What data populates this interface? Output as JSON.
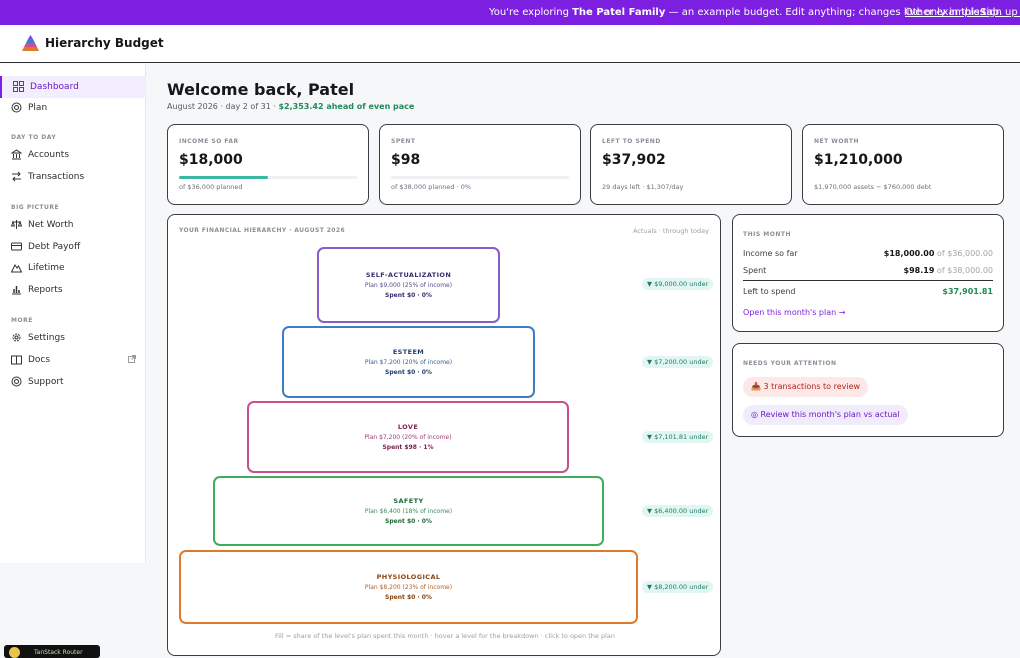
{
  "banner": {
    "prefix": "You're exploring ",
    "family": "The Patel Family",
    "suffix": " — an example budget. Edit anything; changes live only in this tab.",
    "other_examples": "Other examples",
    "sign_up": "Sign up fr"
  },
  "header": {
    "brand": "Hierarchy Budget"
  },
  "sidebar": {
    "items": [
      {
        "label": "Dashboard",
        "icon": "grid-icon"
      },
      {
        "label": "Plan",
        "icon": "target-icon"
      }
    ],
    "section_day": "DAY TO DAY",
    "day_items": [
      {
        "label": "Accounts",
        "icon": "bank-icon"
      },
      {
        "label": "Transactions",
        "icon": "arrows-icon"
      }
    ],
    "section_big": "BIG PICTURE",
    "big_items": [
      {
        "label": "Net Worth",
        "icon": "scale-icon"
      },
      {
        "label": "Debt Payoff",
        "icon": "card-icon"
      },
      {
        "label": "Lifetime",
        "icon": "mountain-icon"
      },
      {
        "label": "Reports",
        "icon": "bar-chart-icon"
      }
    ],
    "section_more": "MORE",
    "more_items": [
      {
        "label": "Settings",
        "icon": "gear-icon"
      },
      {
        "label": "Docs",
        "icon": "book-icon"
      },
      {
        "label": "Support",
        "icon": "lifebuoy-icon"
      }
    ]
  },
  "main": {
    "title": "Welcome back, Patel",
    "subtitle": "August 2026 · day 2 of 31 · ",
    "subtitle_highlight": "$2,353.42 ahead of even pace"
  },
  "cards": [
    {
      "label": "INCOME SO FAR",
      "value": "$18,000",
      "note": "of $36,000 planned",
      "progress": 0.5
    },
    {
      "label": "SPENT",
      "value": "$98",
      "note": "of $38,000 planned · 0%",
      "progress": 0.0
    },
    {
      "label": "LEFT TO SPEND",
      "value": "$37,902",
      "note": "29 days left · $1,307/day"
    },
    {
      "label": "NET WORTH",
      "value": "$1,210,000",
      "note": "$1,970,000 assets − $760,000 debt"
    }
  ],
  "hierarchy": {
    "label": "YOUR FINANCIAL HIERARCHY · AUGUST 2026",
    "right_label": "Actuals · through today",
    "levels": [
      {
        "name": "SELF-ACTUALIZATION",
        "plan": "Plan $9,000 (25% of income)",
        "spent": "Spent $0 · 0%",
        "badge": "▼ $9,000.00 under",
        "color": "#8a5cc9"
      },
      {
        "name": "ESTEEM",
        "plan": "Plan $7,200 (20% of income)",
        "spent": "Spent $0 · 0%",
        "badge": "▼ $7,200.00 under",
        "color": "#3d7cc9"
      },
      {
        "name": "LOVE",
        "plan": "Plan $7,200 (20% of income)",
        "spent": "Spent $98 · 1%",
        "badge": "▼ $7,101.81 under",
        "color": "#c94f8f"
      },
      {
        "name": "SAFETY",
        "plan": "Plan $6,400 (18% of income)",
        "spent": "Spent $0 · 0%",
        "badge": "▼ $6,400.00 under",
        "color": "#3fae5a"
      },
      {
        "name": "PHYSIOLOGICAL",
        "plan": "Plan $8,200 (23% of income)",
        "spent": "Spent $0 · 0%",
        "badge": "▼ $8,200.00 under",
        "color": "#e07a2a"
      }
    ],
    "footnote": "Fill = share of the level's plan spent this month · hover a level for the breakdown · click to open the plan"
  },
  "this_month": {
    "label": "THIS MONTH",
    "rows": [
      {
        "label": "Income so far",
        "value": "$18,000.00",
        "of": " of $36,000.00"
      },
      {
        "label": "Spent",
        "value": "$98.19",
        "of": " of $38,000.00"
      }
    ],
    "left_label": "Left to spend",
    "left_value": "$37,901.81",
    "link": "Open this month's plan →"
  },
  "attention": {
    "label": "NEEDS YOUR ATTENTION",
    "chip1": "📥 3 transactions to review",
    "chip2": "◎ Review this month's plan vs actual"
  },
  "router": {
    "label": "TanStack Router"
  },
  "colors": {
    "accent": "#7c1fe0",
    "positive": "#1f8a5b",
    "badge_bg": "#e2f6f1"
  }
}
